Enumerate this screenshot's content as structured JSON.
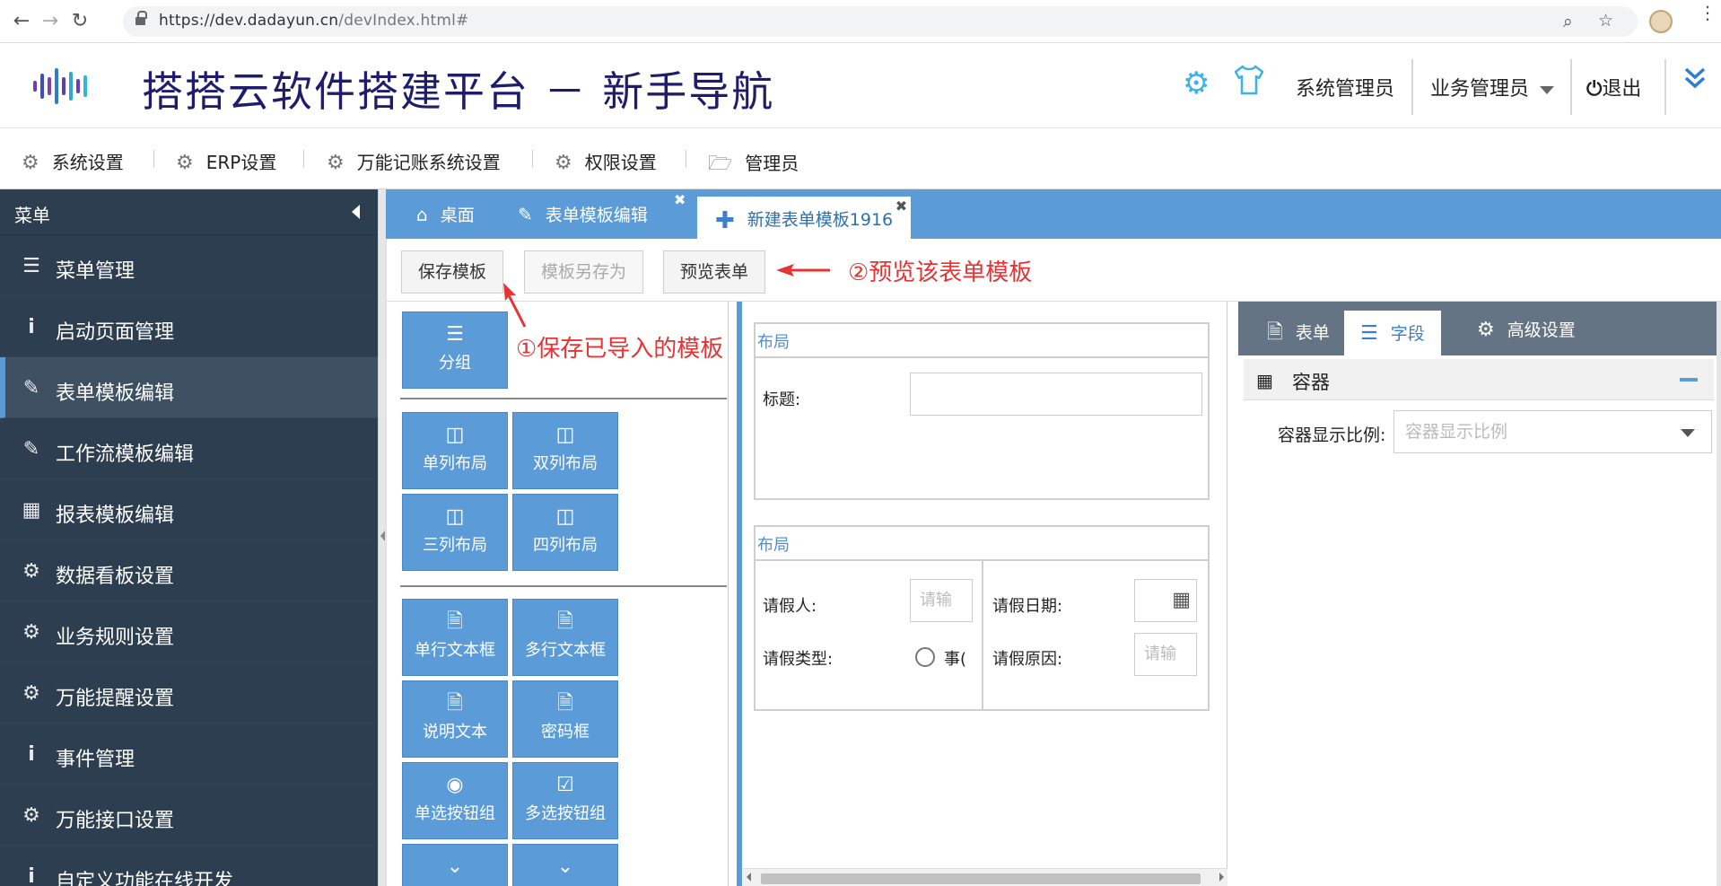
{
  "browser": {
    "url_host": "https://dev.dadayun.cn",
    "url_path": "/devIndex.html#"
  },
  "header": {
    "title": "搭搭云软件搭建平台 － 新手导航",
    "user_system": "系统管理员",
    "user_business": "业务管理员",
    "logout": "退出"
  },
  "topmenu": [
    {
      "label": "系统设置",
      "icon": "gear-icon"
    },
    {
      "label": "ERP设置",
      "icon": "gear-icon"
    },
    {
      "label": "万能记账系统设置",
      "icon": "gear-icon"
    },
    {
      "label": "权限设置",
      "icon": "gear-icon"
    },
    {
      "label": "管理员",
      "icon": "folder-open-icon"
    }
  ],
  "sidebar": {
    "title": "菜单",
    "items": [
      {
        "label": "菜单管理",
        "icon": "list-icon"
      },
      {
        "label": "启动页面管理",
        "icon": "info-icon"
      },
      {
        "label": "表单模板编辑",
        "icon": "edit-icon",
        "active": true
      },
      {
        "label": "工作流模板编辑",
        "icon": "edit-icon"
      },
      {
        "label": "报表模板编辑",
        "icon": "table-icon"
      },
      {
        "label": "数据看板设置",
        "icon": "gear-icon"
      },
      {
        "label": "业务规则设置",
        "icon": "gear-icon"
      },
      {
        "label": "万能提醒设置",
        "icon": "gear-icon"
      },
      {
        "label": "事件管理",
        "icon": "info-icon"
      },
      {
        "label": "万能接口设置",
        "icon": "gear-icon"
      },
      {
        "label": "自定义功能在线开发",
        "icon": "info-icon"
      }
    ]
  },
  "tabs": [
    {
      "label": "桌面",
      "icon": "home-icon"
    },
    {
      "label": "表单模板编辑",
      "icon": "edit-icon"
    },
    {
      "label": "新建表单模板1916",
      "icon": "plus-icon",
      "active": true
    }
  ],
  "toolbar": {
    "save": "保存模板",
    "save_as": "模板另存为",
    "preview": "预览表单"
  },
  "annotations": {
    "preview": "②预览该表单模板",
    "save": "①保存已导入的模板"
  },
  "palette": {
    "group": "分组",
    "layouts": [
      "单列布局",
      "双列布局",
      "三列布局",
      "四列布局"
    ],
    "fields": [
      "单行文本框",
      "多行文本框",
      "说明文本",
      "密码框",
      "单选按钮组",
      "多选按钮组"
    ]
  },
  "canvas": {
    "layout1": {
      "title": "布局",
      "field_label": "标题:"
    },
    "layout2": {
      "title": "布局",
      "applicant": "请假人:",
      "applicant_placeholder": "请输",
      "leave_date": "请假日期:",
      "leave_type": "请假类型:",
      "leave_type_option": "事(",
      "leave_reason": "请假原因:",
      "leave_reason_placeholder": "请输"
    }
  },
  "props": {
    "tabs": [
      {
        "label": "表单",
        "icon": "file-icon"
      },
      {
        "label": "字段",
        "icon": "bars-icon",
        "active": true
      },
      {
        "label": "高级设置",
        "icon": "gear-icon"
      }
    ],
    "section_title": "容器",
    "ratio_label": "容器显示比例:",
    "ratio_placeholder": "容器显示比例"
  },
  "colors": {
    "sidebar_bg": "#2d3e50",
    "tab_bar": "#5a9bd8",
    "palette_button": "#5b9bd8",
    "annotation": "#e63333",
    "title": "#1d1d6b"
  }
}
